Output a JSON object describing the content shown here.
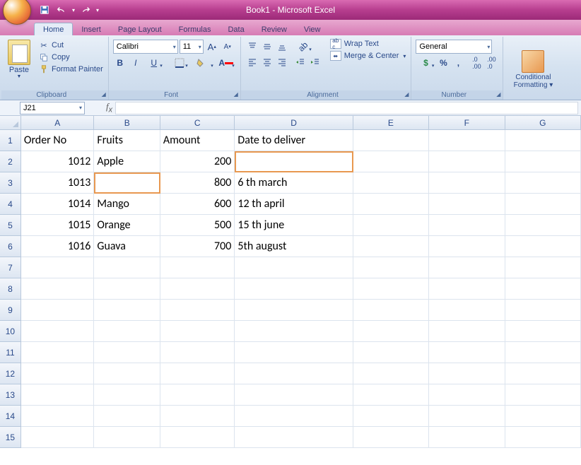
{
  "app": {
    "title": "Book1 - Microsoft Excel"
  },
  "qat": {
    "save_tip": "Save",
    "undo_tip": "Undo",
    "redo_tip": "Redo"
  },
  "tabs": [
    "Home",
    "Insert",
    "Page Layout",
    "Formulas",
    "Data",
    "Review",
    "View"
  ],
  "active_tab": "Home",
  "ribbon": {
    "clipboard": {
      "label": "Clipboard",
      "paste": "Paste",
      "cut": "Cut",
      "copy": "Copy",
      "format_painter": "Format Painter"
    },
    "font": {
      "label": "Font",
      "family": "Calibri",
      "size": "11",
      "bold": "B",
      "italic": "I",
      "underline": "U",
      "grow": "A",
      "shrink": "A",
      "fill_color": "#ffff00",
      "font_color": "#ff0000"
    },
    "alignment": {
      "label": "Alignment",
      "wrap_text": "Wrap Text",
      "merge_center": "Merge & Center"
    },
    "number": {
      "label": "Number",
      "format": "General",
      "currency": "$",
      "percent": "%",
      "comma": ",",
      "inc_dec": ".0",
      "dec_dec": ".00"
    },
    "styles": {
      "conditional": "Conditional\nFormatting"
    }
  },
  "namebox": "J21",
  "formula_bar": "",
  "columns": [
    "A",
    "B",
    "C",
    "D",
    "E",
    "F",
    "G"
  ],
  "visible_rows": 15,
  "sheet": {
    "headers": [
      "Order No",
      "Fruits",
      "Amount",
      "Date to deliver"
    ],
    "rows": [
      {
        "order": "1012",
        "fruit": "Apple",
        "amount": "200",
        "date": ""
      },
      {
        "order": "1013",
        "fruit": "",
        "amount": "800",
        "date": "6 th march"
      },
      {
        "order": "1014",
        "fruit": "Mango",
        "amount": "600",
        "date": "12 th april"
      },
      {
        "order": "1015",
        "fruit": "Orange",
        "amount": "500",
        "date": "15 th june"
      },
      {
        "order": "1016",
        "fruit": "Guava",
        "amount": "700",
        "date": "5th august"
      }
    ]
  },
  "highlights": [
    "D2",
    "B3"
  ]
}
